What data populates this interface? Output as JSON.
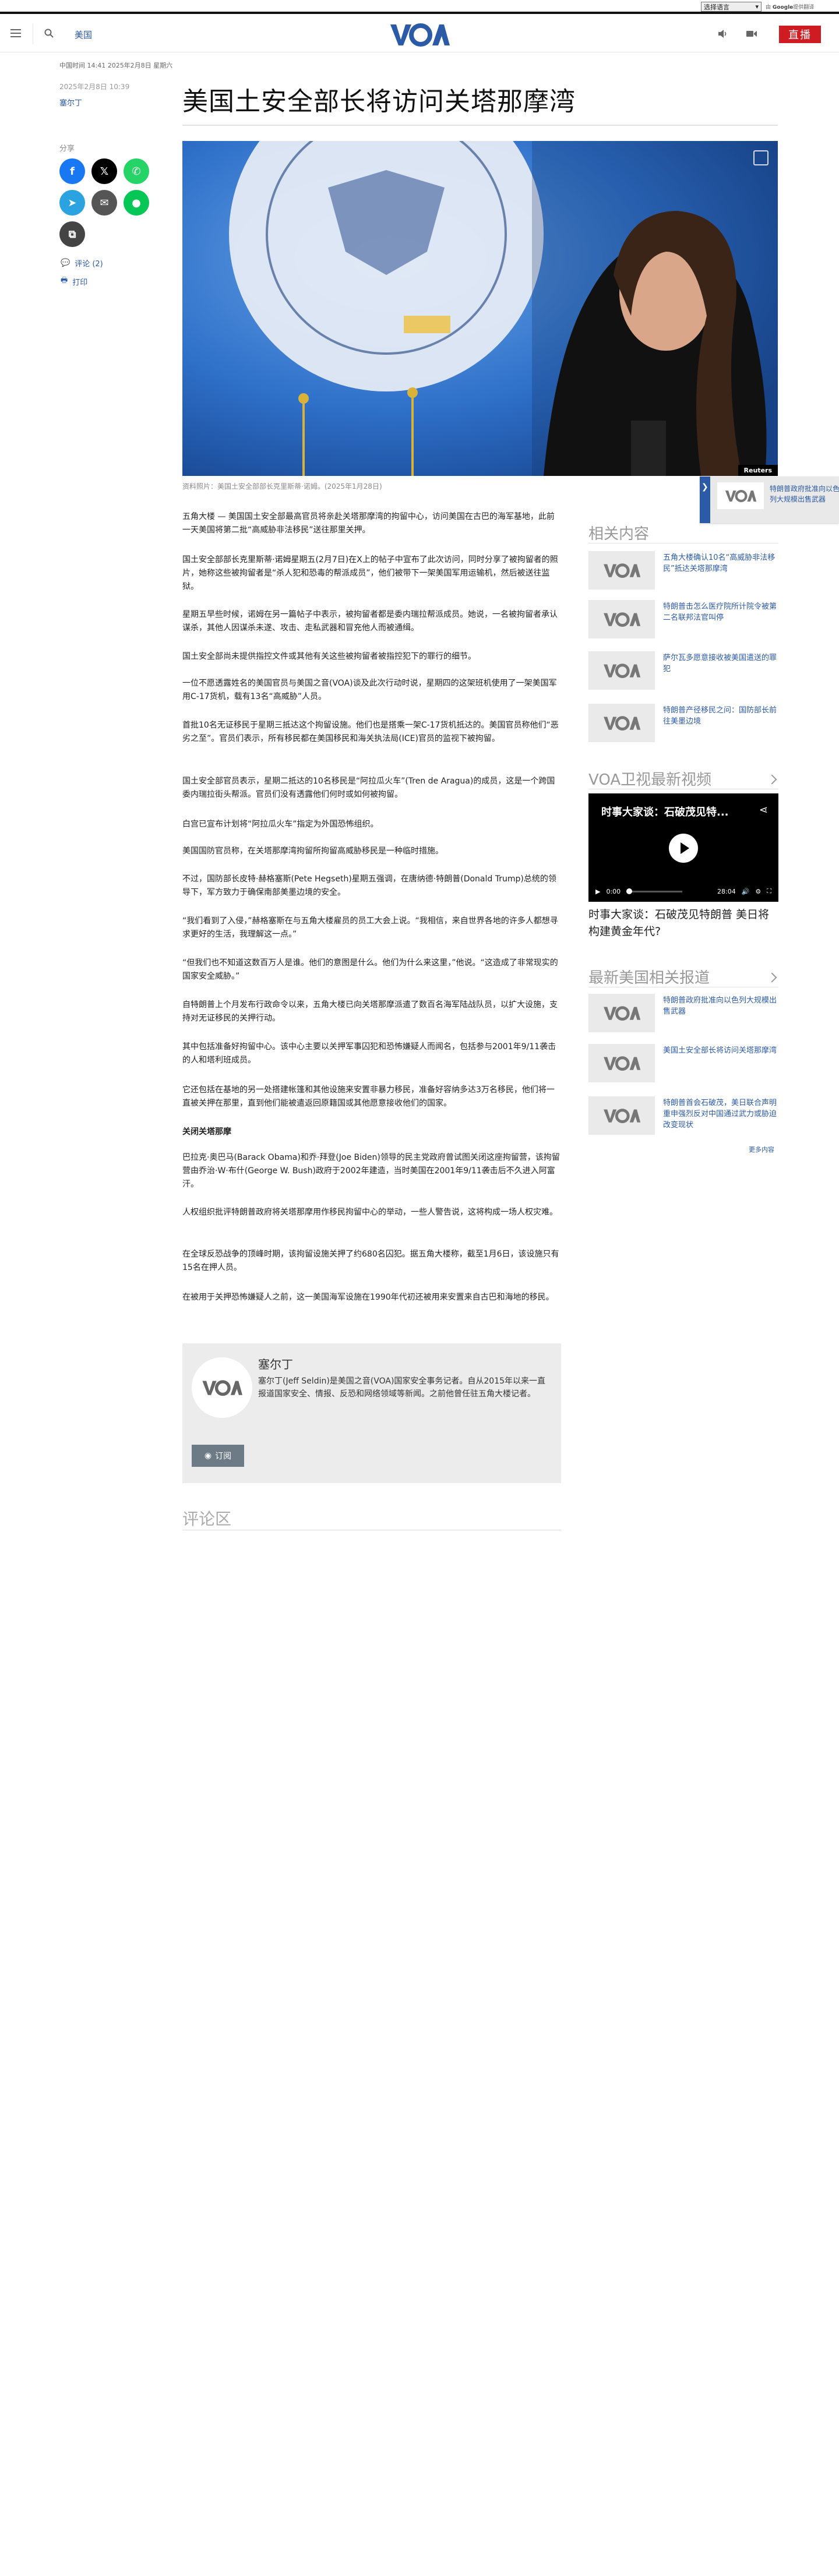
{
  "translate": {
    "select_label": "选择语言",
    "powered_prefix": "由",
    "powered_brand": "Google",
    "powered_suffix": "提供翻译"
  },
  "header": {
    "section": "美国",
    "live_label": "直播",
    "brand_color": "#2b5aa6",
    "live_color": "#cf1c22"
  },
  "meta": {
    "time_line": "中国时间 14:41 2025年2月8日 星期六"
  },
  "article": {
    "date": "2025年2月8日 10:39",
    "author": "塞尔丁",
    "headline": "美国土安全部长将访问关塔那摩湾",
    "caption": "资料照片：美国土安全部部长克里斯蒂·诺姆。(2025年1月28日)",
    "photo_credit": "Reuters",
    "paragraphs": [
      "五角大楼 — 美国国土安全部最高官员将亲赴关塔那摩湾的拘留中心，访问美国在古巴的海军基地，此前一天美国将第二批“高威胁非法移民”送往那里关押。",
      "国土安全部部长克里斯蒂·诺姆星期五(2月7日)在X上的帖子中宣布了此次访问，同时分享了被拘留者的照片，她称这些被拘留者是“杀人犯和恐毒的帮派成员”，他们被带下一架美国军用运输机，然后被送往监狱。",
      "星期五早些时候，诺姆在另一篇帖子中表示，被拘留者都是委内瑞拉帮派成员。她说，一名被拘留者承认谋杀，其他人因谋杀未遂、攻击、走私武器和冒充他人而被通缉。",
      "国土安全部尚未提供指控文件或其他有关这些被拘留者被指控犯下的罪行的细节。",
      "一位不愿透露姓名的美国官员与美国之音(VOA)谈及此次行动时说，星期四的这架班机使用了一架美国军用C-17货机，载有13名“高威胁”人员。",
      "首批10名无证移民于星期三抵达这个拘留设施。他们也是搭乘一架C-17货机抵达的。美国官员称他们“恶劣之至”。官员们表示，所有移民都在美国移民和海关执法局(ICE)官员的监视下被拘留。",
      "国土安全部官员表示，星期二抵达的10名移民是“阿拉瓜火车”(Tren de Aragua)的成员，这是一个跨国委内瑞拉街头帮派。官员们没有透露他们何时或如何被拘留。",
      "白宫已宣布计划将“阿拉瓜火车”指定为外国恐怖组织。",
      "美国国防官员称，在关塔那摩湾拘留所拘留高威胁移民是一种临时措施。",
      "不过，国防部长皮特·赫格塞斯(Pete Hegseth)星期五强调，在唐纳德·特朗普(Donald Trump)总统的领导下，军方致力于确保南部美墨边境的安全。",
      "“我们看到了入侵，”赫格塞斯在与五角大楼雇员的员工大会上说。“我相信，来自世界各地的许多人都想寻求更好的生活，我理解这一点。”",
      "“但我们也不知道这数百万人是谁。他们的意图是什么。他们为什么来这里，”他说。“这造成了非常现实的国家安全威胁。”",
      "自特朗普上个月发布行政命令以来，五角大楼已向关塔那摩派遣了数百名海军陆战队员，以扩大设施，支持对无证移民的关押行动。",
      "其中包括准备好拘留中心。该中心主要以关押军事囚犯和恐怖嫌疑人而闻名，包括参与2001年9/11袭击的人和塔利班成员。",
      "它还包括在基地的另一处搭建帐篷和其他设施来安置非暴力移民，准备好容纳多达3万名移民，他们将一直被关押在那里，直到他们能被遣返回原籍国或其他愿意接收他们的国家。"
    ],
    "subheading": "关闭关塔那摩",
    "paragraphs_2": [
      "巴拉克·奥巴马(Barack Obama)和乔·拜登(Joe Biden)领导的民主党政府曾试图关闭这座拘留营，该拘留营由乔治·W·布什(George W. Bush)政府于2002年建造，当时美国在2001年9/11袭击后不久进入阿富汗。",
      "人权组织批评特朗普政府将关塔那摩用作移民拘留中心的举动，一些人警告说，这将构成一场人权灾难。",
      "在全球反恐战争的顶峰时期，该拘留设施关押了约680名囚犯。据五角大楼称，截至1月6日，该设施只有15名在押人员。",
      "在被用于关押恐怖嫌疑人之前，这一美国海军设施在1990年代初还被用来安置来自古巴和海地的移民。"
    ]
  },
  "share": {
    "label": "分享",
    "comments": "评论 (2)",
    "print": "打印"
  },
  "author_box": {
    "name": "塞尔丁",
    "bio": "塞尔丁(Jeff Seldin)是美国之音(VOA)国家安全事务记者。自从2015年以来一直报道国家安全、情报、反恐和网络领域等新闻。之前他曾任驻五角大楼记者。",
    "subscribe": "订阅"
  },
  "comments": {
    "title": "评论区"
  },
  "sidebar": {
    "related_title": "相关内容",
    "related": [
      "五角大楼确认10名“高威胁非法移民”抵达关塔那摩湾",
      "特朗普击怎么医疗院所计院令被第二名联邦法官叫停",
      "萨尔瓦多愿意接收被美国遣送的罪犯",
      "特朗普产径移民之问：国防部长前往美墨边境"
    ],
    "video_title": "VOA卫视最新视频",
    "video_overlay_title": "时事大家谈：石破茂见特...",
    "video_current": "0:00",
    "video_duration": "28:04",
    "video_caption": "时事大家谈：石破茂见特朗普 美日将构建黄金年代?",
    "latest_title": "最新美国相关报道",
    "latest": [
      "特朗普政府批准向以色列大规模出售武器",
      "美国土安全部长将访问关塔那摩湾",
      "特朗普首会石破茂，美日联合声明重申强烈反对中国通过武力或胁迫改变现状"
    ],
    "more": "更多内容"
  },
  "floating_audio": {
    "text": "特朗普政府批准向以色列大规模出售武器"
  }
}
